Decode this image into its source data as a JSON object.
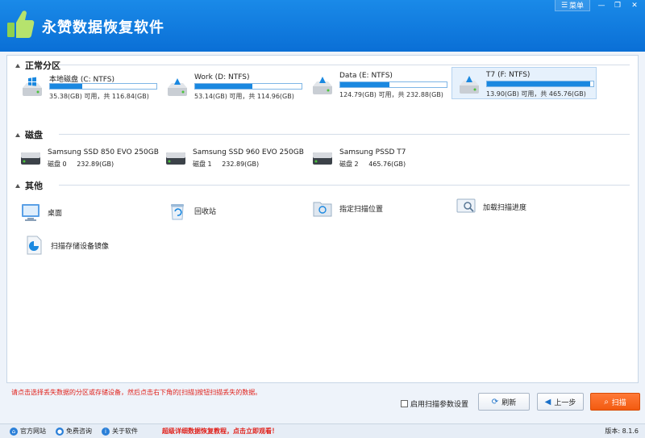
{
  "app": {
    "title": "永赞数据恢复软件",
    "menu_label": "菜单",
    "colors": {
      "header": "#0a6fd6",
      "accent": "#1a88e0",
      "scan_button": "#f25a10",
      "hint": "#e0201a"
    }
  },
  "sections": {
    "partitions_title": "正常分区",
    "disks_title": "磁盘",
    "others_title": "其他"
  },
  "partitions": [
    {
      "name": "本地磁盘 (C: NTFS)",
      "usage_fraction": 0.3,
      "size": "35.38(GB) 可用，共 116.84(GB)",
      "icon": "windows-drive-icon"
    },
    {
      "name": "Work (D: NTFS)",
      "usage_fraction": 0.54,
      "size": "53.14(GB) 可用，共 114.96(GB)",
      "icon": "drive-icon"
    },
    {
      "name": "Data (E: NTFS)",
      "usage_fraction": 0.46,
      "size": "124.79(GB) 可用，共 232.88(GB)",
      "icon": "drive-icon"
    },
    {
      "name": "T7 (F: NTFS)",
      "usage_fraction": 0.97,
      "size": "13.90(GB) 可用，共 465.76(GB)",
      "icon": "drive-icon",
      "selected": true
    }
  ],
  "disks": [
    {
      "name": "Samsung SSD 850 EVO 250GB",
      "label": "磁盘 0",
      "size": "232.89(GB)"
    },
    {
      "name": "Samsung SSD 960 EVO 250GB",
      "label": "磁盘 1",
      "size": "232.89(GB)"
    },
    {
      "name": "Samsung PSSD T7",
      "label": "磁盘 2",
      "size": "465.76(GB)"
    }
  ],
  "others": [
    {
      "label": "桌面",
      "icon": "desktop-icon"
    },
    {
      "label": "回收站",
      "icon": "recycle-bin-icon"
    },
    {
      "label": "指定扫描位置",
      "icon": "folder-scan-icon"
    },
    {
      "label": "加载扫描进度",
      "icon": "load-progress-icon"
    },
    {
      "label": "扫描存储设备镜像",
      "icon": "disk-image-icon"
    }
  ],
  "footer": {
    "hint": "请点击选择丢失数据的分区或存储设备，然后点击右下角的[扫描]按钮扫描丢失的数据。",
    "scan_params_label": "启用扫描参数设置",
    "refresh_label": "刷新",
    "back_label": "上一步",
    "scan_label": "扫描"
  },
  "statusbar": {
    "website": "官方网站",
    "consult": "免费咨询",
    "about": "关于软件",
    "promo": "超级详细数据恢复教程，点击立即观看！",
    "version": "版本: 8.1.6"
  }
}
